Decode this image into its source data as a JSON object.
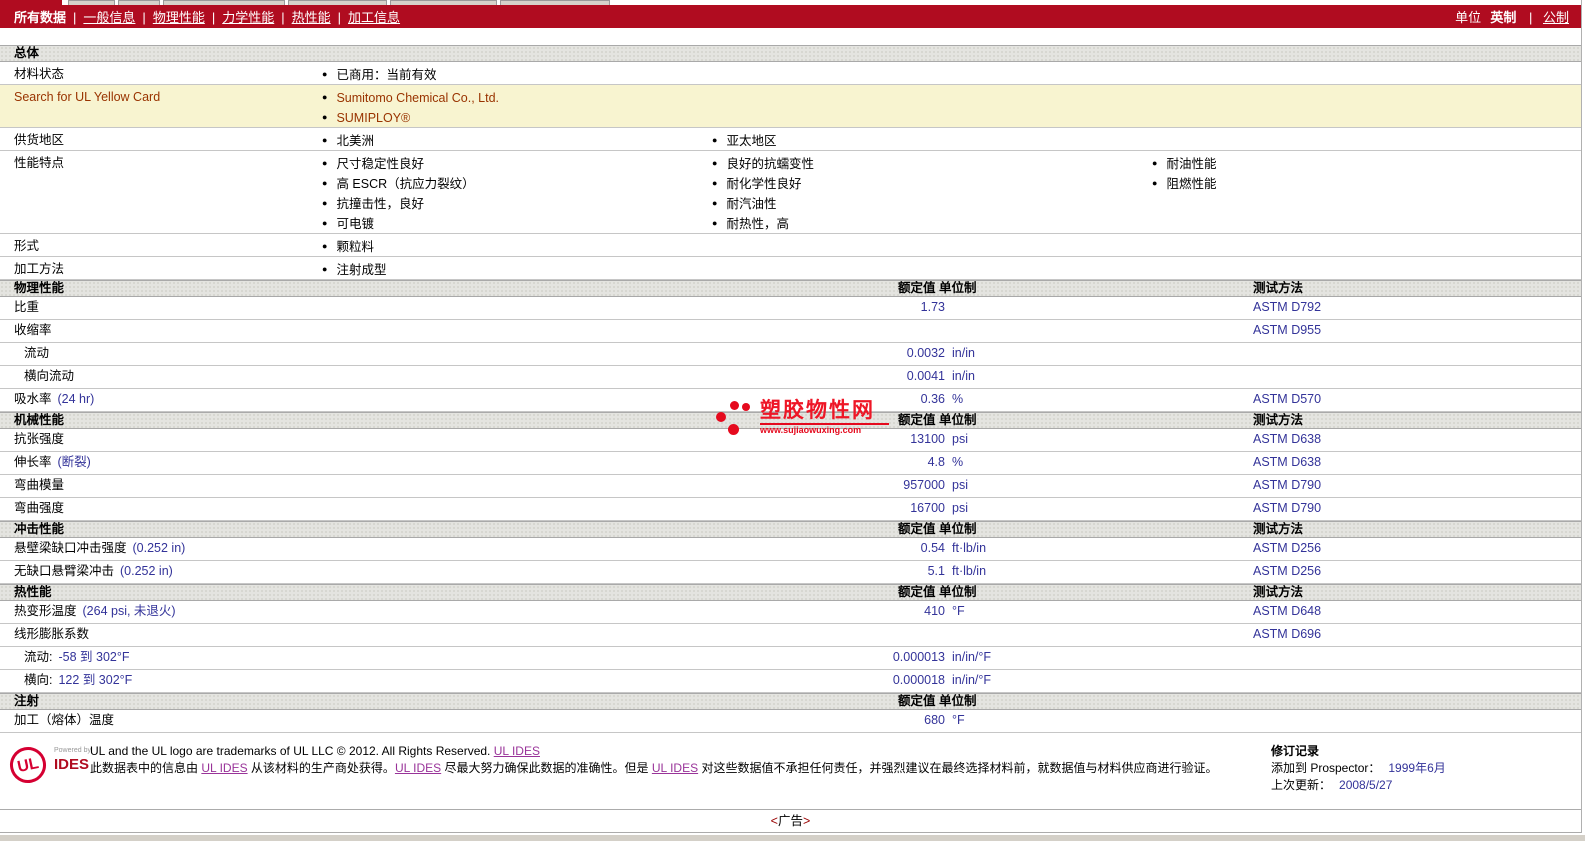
{
  "colors": {
    "navbar_red": "#b00c20",
    "value_navy": "#333399",
    "highlight_yellow": "#f8f4d0",
    "yellowcard_red": "#993300",
    "link_magenta": "#993399",
    "ul_logo_red": "#d50032"
  },
  "nav": {
    "items": [
      {
        "label": "所有数据",
        "active": true
      },
      {
        "label": "一般信息",
        "active": false
      },
      {
        "label": "物理性能",
        "active": false
      },
      {
        "label": "力学性能",
        "active": false
      },
      {
        "label": "热性能",
        "active": false
      },
      {
        "label": "加工信息",
        "active": false
      }
    ]
  },
  "units_bar": {
    "label": "单位",
    "english_label": "英制",
    "metric_label": "公制"
  },
  "table_headers": {
    "value": "额定值 单位制",
    "test": "测试方法"
  },
  "general": {
    "title": "总体",
    "rows": [
      {
        "label": "材料状态",
        "highlight": false,
        "cols": [
          [
            "已商用：当前有效"
          ]
        ]
      },
      {
        "label": "Search for UL Yellow Card",
        "highlight": true,
        "cols": [
          [
            "Sumitomo Chemical Co., Ltd.",
            "SUMIPLOY®"
          ]
        ]
      },
      {
        "label": "供货地区",
        "highlight": false,
        "cols": [
          [
            "北美洲"
          ],
          [
            "亚太地区"
          ]
        ]
      },
      {
        "label": "性能特点",
        "highlight": false,
        "cols": [
          [
            "尺寸稳定性良好",
            "高 ESCR（抗应力裂纹）",
            "抗撞击性，良好",
            "可电镀"
          ],
          [
            "良好的抗蠕变性",
            "耐化学性良好",
            "耐汽油性",
            "耐热性，高"
          ],
          [
            "耐油性能",
            "阻燃性能"
          ]
        ]
      },
      {
        "label": "形式",
        "highlight": false,
        "cols": [
          [
            "颗粒料"
          ]
        ]
      },
      {
        "label": "加工方法",
        "highlight": false,
        "cols": [
          [
            "注射成型"
          ]
        ]
      }
    ]
  },
  "property_sections": [
    {
      "title": "物理性能",
      "show_value_header": true,
      "show_test_header": true,
      "rows": [
        {
          "label": "比重",
          "note": "",
          "indent": false,
          "value": "1.73",
          "unit": "",
          "test": "ASTM D792"
        },
        {
          "label": "收缩率",
          "note": "",
          "indent": false,
          "value": "",
          "unit": "",
          "test": "ASTM D955"
        },
        {
          "label": "流动",
          "note": "",
          "indent": true,
          "value": "0.0032",
          "unit": "in/in",
          "test": ""
        },
        {
          "label": "横向流动",
          "note": "",
          "indent": true,
          "value": "0.0041",
          "unit": "in/in",
          "test": ""
        },
        {
          "label": "吸水率",
          "note": "(24 hr)",
          "indent": false,
          "value": "0.36",
          "unit": "%",
          "test": "ASTM D570"
        }
      ]
    },
    {
      "title": "机械性能",
      "show_value_header": true,
      "show_test_header": true,
      "rows": [
        {
          "label": "抗张强度",
          "note": "",
          "indent": false,
          "value": "13100",
          "unit": "psi",
          "test": "ASTM D638"
        },
        {
          "label": "伸长率",
          "note": "(断裂)",
          "indent": false,
          "value": "4.8",
          "unit": "%",
          "test": "ASTM D638"
        },
        {
          "label": "弯曲模量",
          "note": "",
          "indent": false,
          "value": "957000",
          "unit": "psi",
          "test": "ASTM D790"
        },
        {
          "label": "弯曲强度",
          "note": "",
          "indent": false,
          "value": "16700",
          "unit": "psi",
          "test": "ASTM D790"
        }
      ]
    },
    {
      "title": "冲击性能",
      "show_value_header": true,
      "show_test_header": true,
      "rows": [
        {
          "label": "悬壁梁缺口冲击强度",
          "note": "(0.252 in)",
          "indent": false,
          "value": "0.54",
          "unit": "ft·lb/in",
          "test": "ASTM D256"
        },
        {
          "label": "无缺口悬臂梁冲击",
          "note": "(0.252 in)",
          "indent": false,
          "value": "5.1",
          "unit": "ft·lb/in",
          "test": "ASTM D256"
        }
      ]
    },
    {
      "title": "热性能",
      "show_value_header": true,
      "show_test_header": true,
      "rows": [
        {
          "label": "热变形温度",
          "note": "(264 psi, 未退火)",
          "indent": false,
          "value": "410",
          "unit": "°F",
          "test": "ASTM D648"
        },
        {
          "label": "线形膨胀系数",
          "note": "",
          "indent": false,
          "value": "",
          "unit": "",
          "test": "ASTM D696"
        },
        {
          "label": "流动:",
          "note": "-58 到 302°F",
          "indent": true,
          "value": "0.000013",
          "unit": "in/in/°F",
          "test": ""
        },
        {
          "label": "横向:",
          "note": "122 到 302°F",
          "indent": true,
          "value": "0.000018",
          "unit": "in/in/°F",
          "test": ""
        }
      ]
    },
    {
      "title": "注射",
      "show_value_header": true,
      "show_test_header": false,
      "rows": [
        {
          "label": "加工（熔体）温度",
          "note": "",
          "indent": false,
          "value": "680",
          "unit": "°F",
          "test": ""
        }
      ]
    }
  ],
  "watermark": {
    "site_name": "塑胶物性网",
    "site_url": "www.sujiaowuxing.com"
  },
  "footer": {
    "logo": {
      "ul": "UL",
      "powered_by": "Powered by",
      "brand": "IDES"
    },
    "line1_segments": [
      {
        "text": "UL and the UL logo are trademarks of UL LLC © 2012. All Rights Reserved. ",
        "link": false
      },
      {
        "text": "UL IDES",
        "link": true
      }
    ],
    "line2_segments": [
      {
        "text": "此数据表中的信息由 ",
        "link": false
      },
      {
        "text": "UL IDES",
        "link": true
      },
      {
        "text": " 从该材料的生产商处获得。",
        "link": false
      },
      {
        "text": "UL IDES",
        "link": true
      },
      {
        "text": " 尽最大努力确保此数据的准确性。但是 ",
        "link": false
      },
      {
        "text": "UL IDES",
        "link": true
      },
      {
        "text": " 对这些数据值不承担任何责任，并强烈建议在最终选择材料前，就数据值与材料供应商进行验证。",
        "link": false
      }
    ],
    "revision": {
      "title": "修订记录",
      "rows": [
        {
          "label": "添加到  Prospector：",
          "value": "1999年6月"
        },
        {
          "label": "上次更新：",
          "value": "2008/5/27"
        }
      ]
    }
  },
  "advert": {
    "open": "<",
    "label": "广告",
    "close": ">"
  }
}
